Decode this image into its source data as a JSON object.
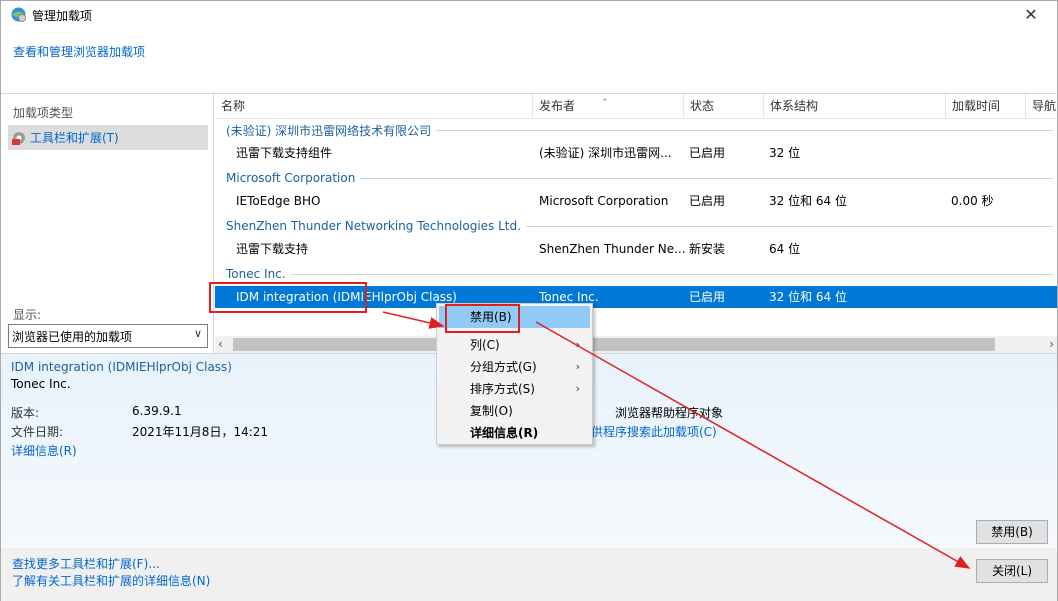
{
  "window": {
    "title": "管理加载项",
    "close_label": "✕",
    "header_link": "查看和管理浏览器加载项"
  },
  "sidebar": {
    "section_label": "加载项类型",
    "items": [
      {
        "label": "工具栏和扩展(T)",
        "icon": "gear-puzzle-icon"
      }
    ],
    "show_label": "显示:",
    "show_value": "浏览器已使用的加载项"
  },
  "list": {
    "columns": [
      "名称",
      "发布者",
      "状态",
      "体系结构",
      "加载时间",
      "导航"
    ],
    "groups": [
      {
        "name": "(未验证) 深圳市迅雷网络技术有限公司",
        "rows": [
          {
            "name": "迅雷下载支持组件",
            "publisher": "(未验证) 深圳市迅雷网...",
            "status": "已启用",
            "arch": "32 位",
            "load_time": "",
            "nav": ""
          }
        ]
      },
      {
        "name": "Microsoft Corporation",
        "rows": [
          {
            "name": "IEToEdge BHO",
            "publisher": "Microsoft Corporation",
            "status": "已启用",
            "arch": "32 位和 64 位",
            "load_time": "0.00 秒",
            "nav": ""
          }
        ]
      },
      {
        "name": "ShenZhen Thunder Networking Technologies Ltd.",
        "rows": [
          {
            "name": "迅雷下载支持",
            "publisher": "ShenZhen Thunder Ne...",
            "status": "新安装",
            "arch": "64 位",
            "load_time": "",
            "nav": ""
          }
        ]
      },
      {
        "name": "Tonec Inc.",
        "rows": [
          {
            "name": "IDM integration (IDMIEHlprObj Class)",
            "publisher": "Tonec Inc.",
            "status": "已启用",
            "arch": "32 位和 64 位",
            "load_time": "",
            "nav": ""
          }
        ]
      }
    ]
  },
  "details": {
    "title": "IDM integration (IDMIEHlprObj Class)",
    "publisher": "Tonec Inc.",
    "version_label": "版本:",
    "version_value": "6.39.9.1",
    "date_label": "文件日期:",
    "date_value": "2021年11月8日，14:21",
    "more_info_link": "详细信息(R)",
    "type_value": "浏览器帮助程序对象",
    "search_link": "供程序搜索此加载项(C)",
    "disable_button": "禁用(B)"
  },
  "footer": {
    "find_more_link": "查找更多工具栏和扩展(F)...",
    "learn_more_link": "了解有关工具栏和扩展的详细信息(N)",
    "close_button": "关闭(L)"
  },
  "context_menu": {
    "items": [
      {
        "label": "禁用(B)",
        "highlighted": true,
        "submenu": false,
        "bold": false
      },
      {
        "label": "列(C)",
        "highlighted": false,
        "submenu": true,
        "bold": false
      },
      {
        "label": "分组方式(G)",
        "highlighted": false,
        "submenu": true,
        "bold": false
      },
      {
        "label": "排序方式(S)",
        "highlighted": false,
        "submenu": true,
        "bold": false
      },
      {
        "label": "复制(O)",
        "highlighted": false,
        "submenu": false,
        "bold": false
      },
      {
        "label": "详细信息(R)",
        "highlighted": false,
        "submenu": false,
        "bold": true
      }
    ]
  },
  "colors": {
    "link": "#0066cc",
    "selection": "#0078d7",
    "menu_highlight": "#91c9f7",
    "annotation": "#e02020"
  }
}
